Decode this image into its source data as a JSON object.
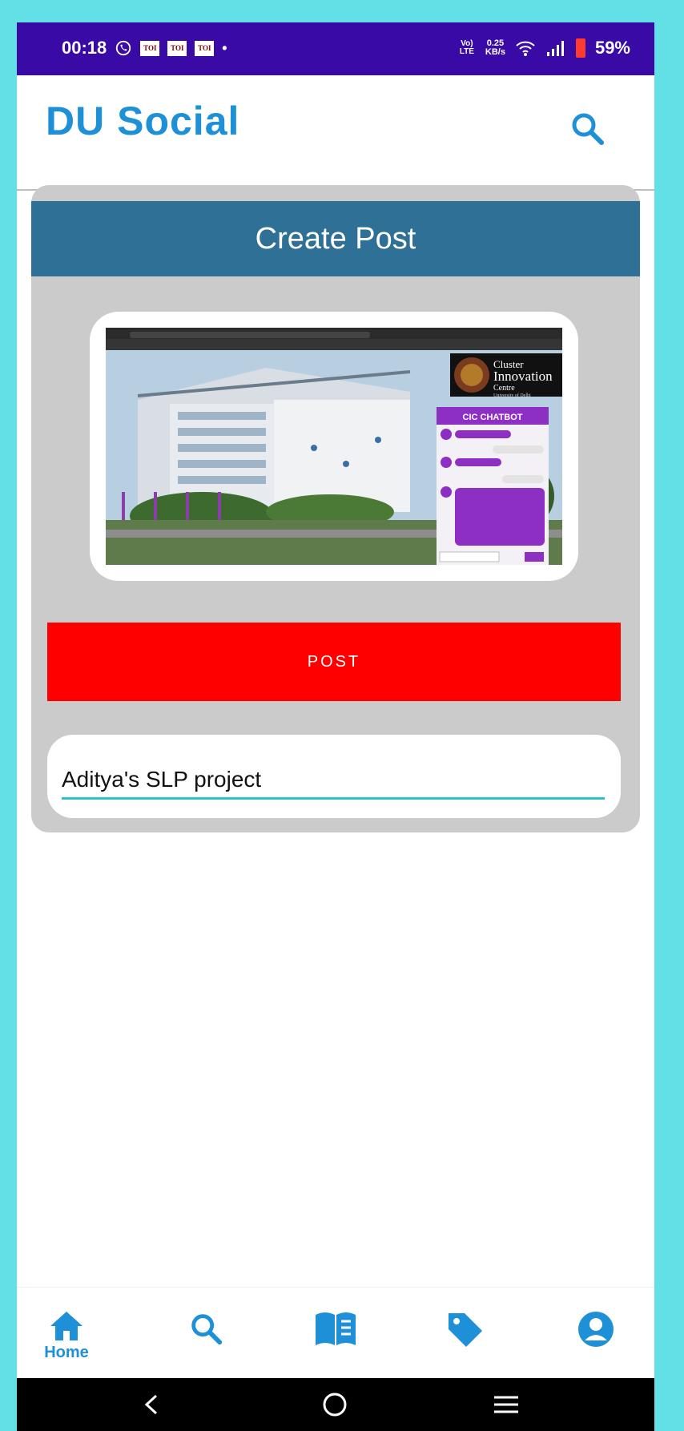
{
  "status": {
    "time": "00:18",
    "toi_badges": [
      "TOI",
      "TOI",
      "TOI"
    ],
    "lte_label": "Vo) LTE",
    "net_speed_value": "0.25",
    "net_speed_unit": "KB/s",
    "battery": "59%"
  },
  "app": {
    "title": "DU Social"
  },
  "create_post": {
    "header": "Create Post",
    "post_button": "POST",
    "caption_value": "Aditya's SLP project"
  },
  "image": {
    "logo_line1": "Cluster",
    "logo_line2": "Innovation",
    "logo_line3": "Centre",
    "logo_line4": "University of Delhi",
    "chatbot_title": "CIC CHATBOT"
  },
  "bottom_nav": {
    "home_label": "Home"
  },
  "colors": {
    "brand_blue": "#1e90d8",
    "status_bar": "#3a0aa7",
    "card_header": "#2f7196",
    "post_button": "#ff0000",
    "background": "#62e0e6"
  }
}
